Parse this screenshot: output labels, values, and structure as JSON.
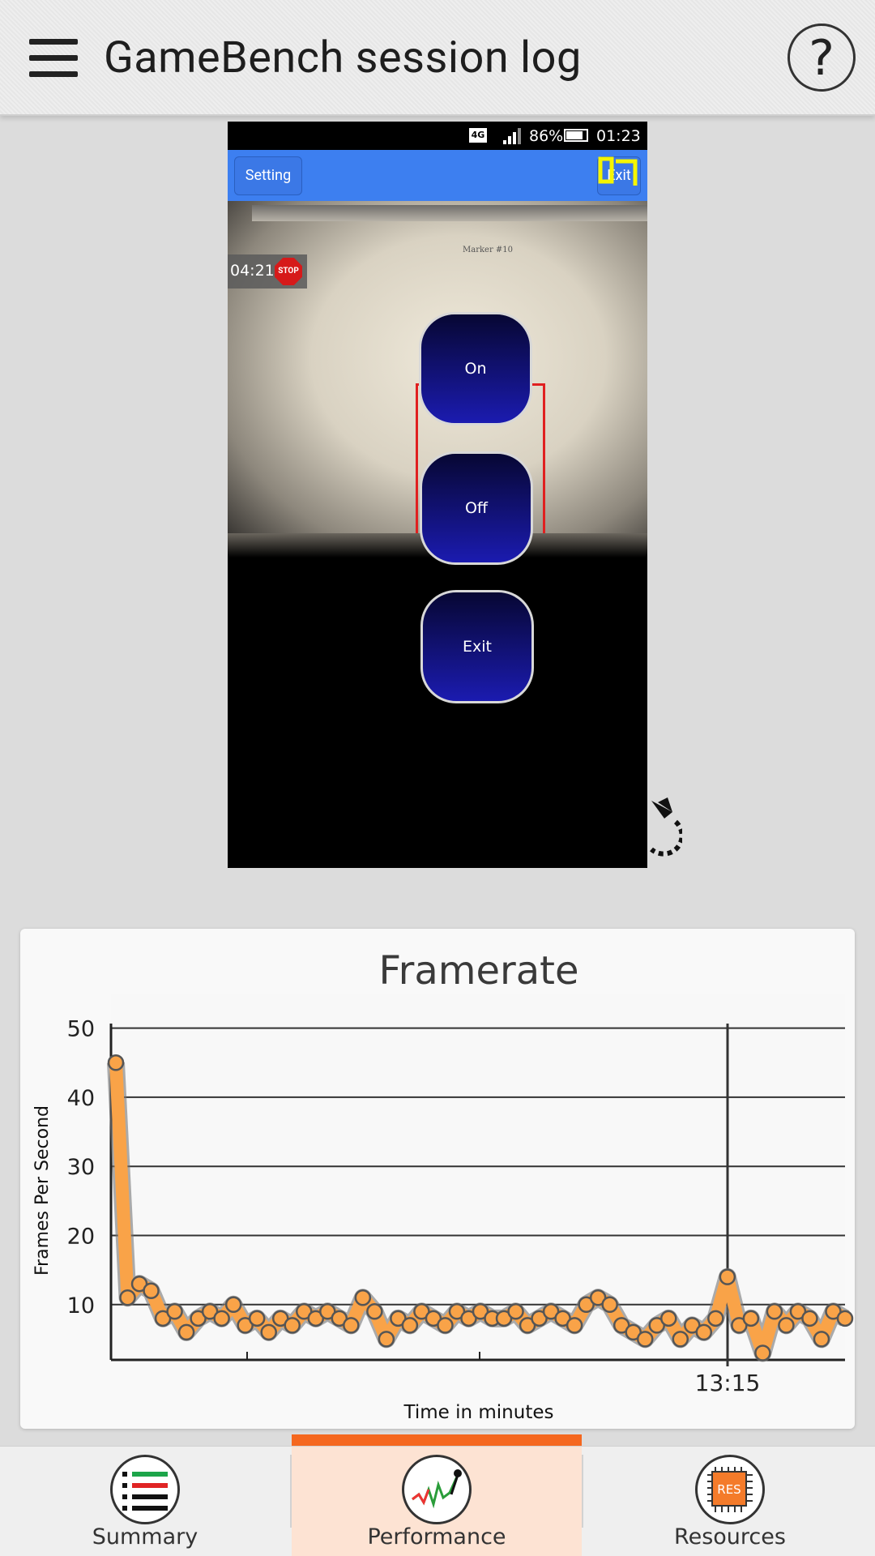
{
  "appbar": {
    "title": "GameBench session log",
    "help_label": "?"
  },
  "phone": {
    "status": {
      "network": "4G",
      "battery": "86%",
      "time": "01:23"
    },
    "toolbar": {
      "setting_label": "Setting",
      "exit_label": "Exit"
    },
    "recording": {
      "elapsed": "04:21",
      "stop_label": "STOP"
    },
    "marker": {
      "id": "10",
      "page_title": "Marker #10"
    },
    "buttons": {
      "on_label": "On",
      "off_label": "Off",
      "exit_label": "Exit"
    }
  },
  "chart_data": {
    "type": "line",
    "title": "Framerate",
    "xlabel": "Time in minutes",
    "ylabel": "Frames Per Second",
    "yticks": [
      10,
      20,
      30,
      40,
      50
    ],
    "ylim": [
      2,
      55
    ],
    "xtick_labels": [
      "13:15"
    ],
    "grid": true,
    "series": [
      {
        "color": "#f9a348",
        "values": [
          45,
          11,
          13,
          12,
          8,
          9,
          6,
          8,
          9,
          8,
          10,
          7,
          8,
          6,
          8,
          7,
          9,
          8,
          9,
          8,
          7,
          11,
          9,
          5,
          8,
          7,
          9,
          8,
          7,
          9,
          8,
          9,
          8,
          8,
          9,
          7,
          8,
          9,
          8,
          7,
          10,
          11,
          10,
          7,
          6,
          5,
          7,
          8,
          5,
          7,
          6,
          8,
          14,
          7,
          8,
          3,
          9,
          7,
          9,
          8,
          5,
          9,
          8
        ]
      }
    ]
  },
  "nav": {
    "tabs": [
      {
        "label": "Summary"
      },
      {
        "label": "Performance"
      },
      {
        "label": "Resources",
        "icon_text": "RES"
      }
    ]
  },
  "colors": {
    "accent": "#f5671e",
    "active_tab": "#fde3d3",
    "line": "#f9a348",
    "phone_toolbar": "#3d7ff0"
  }
}
